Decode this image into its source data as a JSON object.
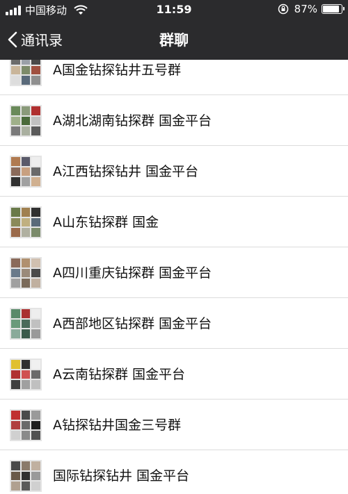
{
  "status_bar": {
    "carrier": "中国移动",
    "time": "11:59",
    "battery": "87%",
    "battery_level": 0.87
  },
  "nav": {
    "back_label": "通讯录",
    "title": "群聊"
  },
  "groups": [
    {
      "name": "A国金钻探钻井五号群",
      "colors": [
        "#6b6b6b",
        "#9aa0a8",
        "#4a4a4a",
        "#c9b59a",
        "#7d8b6a",
        "#a05040",
        "#dddddd",
        "#5a6a7a",
        "#8f8f8f"
      ]
    },
    {
      "name": "A湖北湖南钻探群 国金平台",
      "colors": [
        "#6a8a5a",
        "#8a9a7a",
        "#b03030",
        "#9fb08a",
        "#4a6a3a",
        "#c0c0c0",
        "#7a7a7a",
        "#aab0a0",
        "#5a5a5a"
      ]
    },
    {
      "name": "A江西钻探钻井 国金平台",
      "colors": [
        "#b07a50",
        "#5a5a6a",
        "#eeeeee",
        "#8a6a5a",
        "#c8a080",
        "#6a6a6a",
        "#303030",
        "#a0a0a0",
        "#d0b090"
      ]
    },
    {
      "name": "A山东钻探群 国金",
      "colors": [
        "#6a7a4a",
        "#a08050",
        "#303030",
        "#8a8a5a",
        "#c0b080",
        "#5a6a7a",
        "#9a6a4a",
        "#b0b0a0",
        "#7a8a6a"
      ]
    },
    {
      "name": "A四川重庆钻探群 国金平台",
      "colors": [
        "#8a6a5a",
        "#b09070",
        "#d0c0b0",
        "#6a7a8a",
        "#9a8a7a",
        "#4a4a4a",
        "#a0a0a0",
        "#7a6a5a",
        "#c0b0a0"
      ]
    },
    {
      "name": "A西部地区钻探群 国金平台",
      "colors": [
        "#5a8a6a",
        "#aa3030",
        "#eeeeee",
        "#6a9a7a",
        "#4a6a5a",
        "#c0c0c0",
        "#8aaa9a",
        "#3a5a4a",
        "#9a9a9a"
      ]
    },
    {
      "name": "A云南钻探群 国金平台",
      "colors": [
        "#e0c030",
        "#303030",
        "#f0f0f0",
        "#b03030",
        "#d05050",
        "#6a6a6a",
        "#404040",
        "#a0a0a0",
        "#c0c0c0"
      ]
    },
    {
      "name": "A钻探钻井国金三号群",
      "colors": [
        "#c03030",
        "#4a4a4a",
        "#9a9a9a",
        "#b04040",
        "#6a6a6a",
        "#202020",
        "#d0d0d0",
        "#8a8a8a",
        "#505050"
      ]
    },
    {
      "name": "国际钻探钻井 国金平台",
      "colors": [
        "#4a4a4a",
        "#8a7a6a",
        "#c0b0a0",
        "#6a5a4a",
        "#303030",
        "#9a9a9a",
        "#b0a090",
        "#5a5a5a",
        "#d0d0d0"
      ]
    }
  ]
}
